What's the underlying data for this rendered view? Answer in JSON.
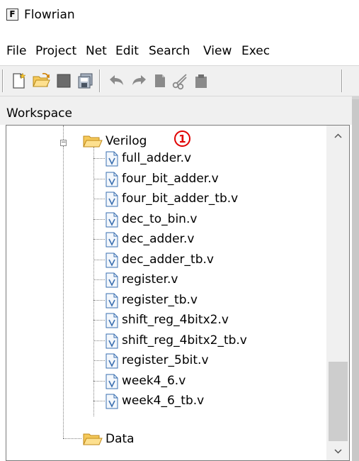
{
  "window": {
    "title": "Flowrian",
    "icon_letter": "F"
  },
  "menu": [
    "File",
    "Project",
    "Net",
    "Edit",
    "Search",
    "View",
    "Exec"
  ],
  "toolbar_icons": [
    "new-file-icon",
    "open-folder-icon",
    "save-icon",
    "save-all-icon",
    "undo-icon",
    "redo-icon",
    "copy-icon",
    "cut-icon",
    "paste-icon"
  ],
  "workspace": {
    "label": "Workspace"
  },
  "tree": {
    "folder": {
      "name": "Verilog",
      "badge": "1"
    },
    "files": [
      "full_adder.v",
      "four_bit_adder.v",
      "four_bit_adder_tb.v",
      "dec_to_bin.v",
      "dec_adder.v",
      "dec_adder_tb.v",
      "register.v",
      "register_tb.v",
      "shift_reg_4bitx2.v",
      "shift_reg_4bitx2_tb.v",
      "register_5bit.v",
      "week4_6.v",
      "week4_6_tb.v"
    ],
    "second_folder": {
      "name": "Data"
    },
    "file_icon_letter": "V"
  },
  "colors": {
    "accent_badge": "#e00000",
    "folder": "#f2c45a",
    "file_icon": "#3a6fb0"
  }
}
